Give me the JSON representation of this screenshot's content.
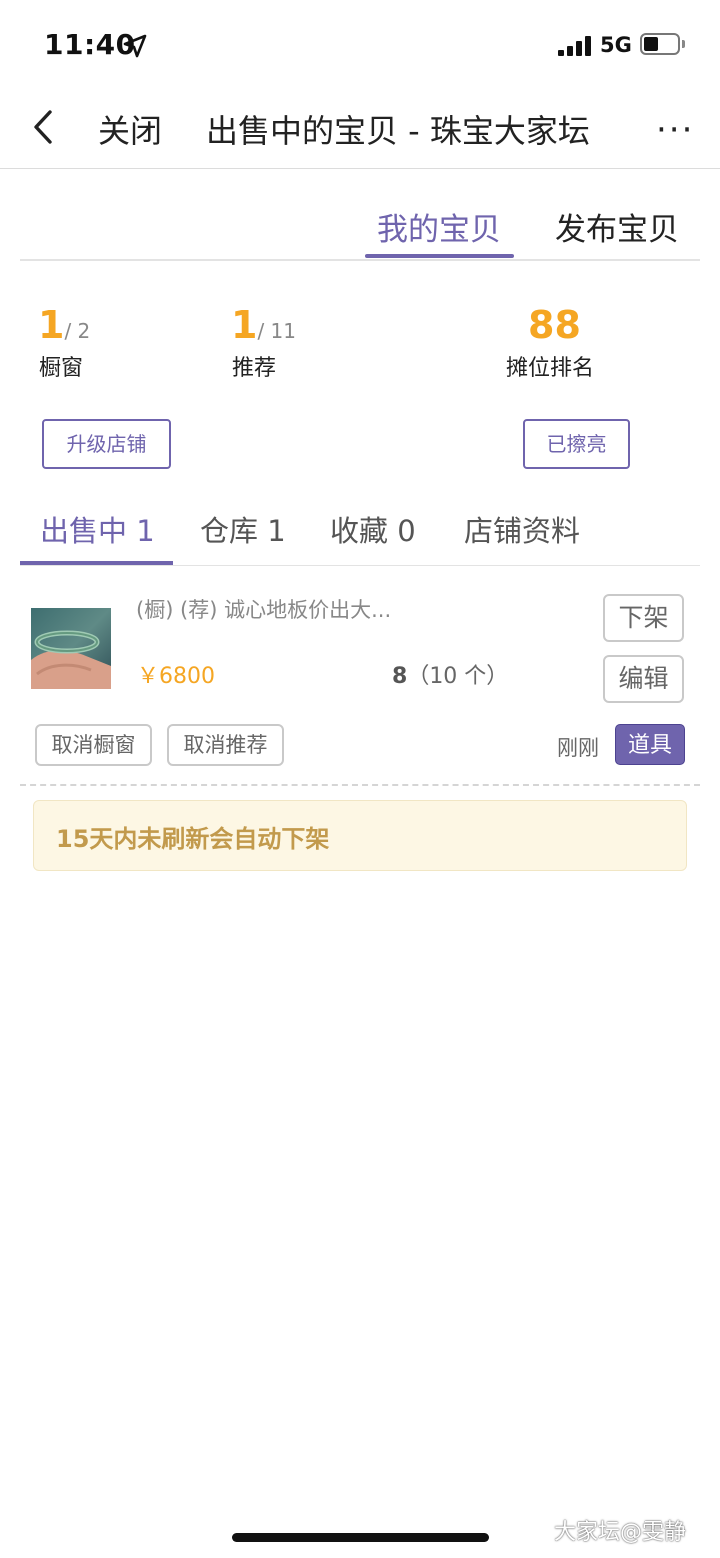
{
  "status_bar": {
    "time": "11:40",
    "network": "5G"
  },
  "header": {
    "close_label": "关闭",
    "title": "出售中的宝贝 - 珠宝大家坛",
    "more_label": "···"
  },
  "top_tabs": [
    {
      "label": "我的宝贝",
      "active": true
    },
    {
      "label": "发布宝贝",
      "active": false
    }
  ],
  "stats": {
    "window": {
      "value": "1",
      "total": "/ 2",
      "label": "橱窗"
    },
    "recommend": {
      "value": "1",
      "total": "/ 11",
      "label": "推荐"
    },
    "rank": {
      "value": "88",
      "label": "摊位排名"
    }
  },
  "buttons": {
    "upgrade": "升级店铺",
    "polished": "已擦亮"
  },
  "sub_tabs": [
    {
      "label": "出售中 1",
      "active": true
    },
    {
      "label": "仓库 1",
      "active": false
    },
    {
      "label": "收藏 0",
      "active": false
    },
    {
      "label": "店铺资料",
      "active": false
    }
  ],
  "item": {
    "title": "(橱) (荐) 诚心地板价出大...",
    "price": "￥6800",
    "views": "8",
    "views_extra": "（10 个）",
    "delist": "下架",
    "edit": "编辑",
    "cancel_window": "取消橱窗",
    "cancel_recommend": "取消推荐",
    "time": "刚刚",
    "tools": "道具"
  },
  "notice": "15天内未刷新会自动下架",
  "watermark": "大家坛@雯静",
  "colors": {
    "accent": "#6f64ad",
    "price": "#f5a623",
    "notice_bg": "#fdf7e4",
    "notice_text": "#c29a4c"
  }
}
